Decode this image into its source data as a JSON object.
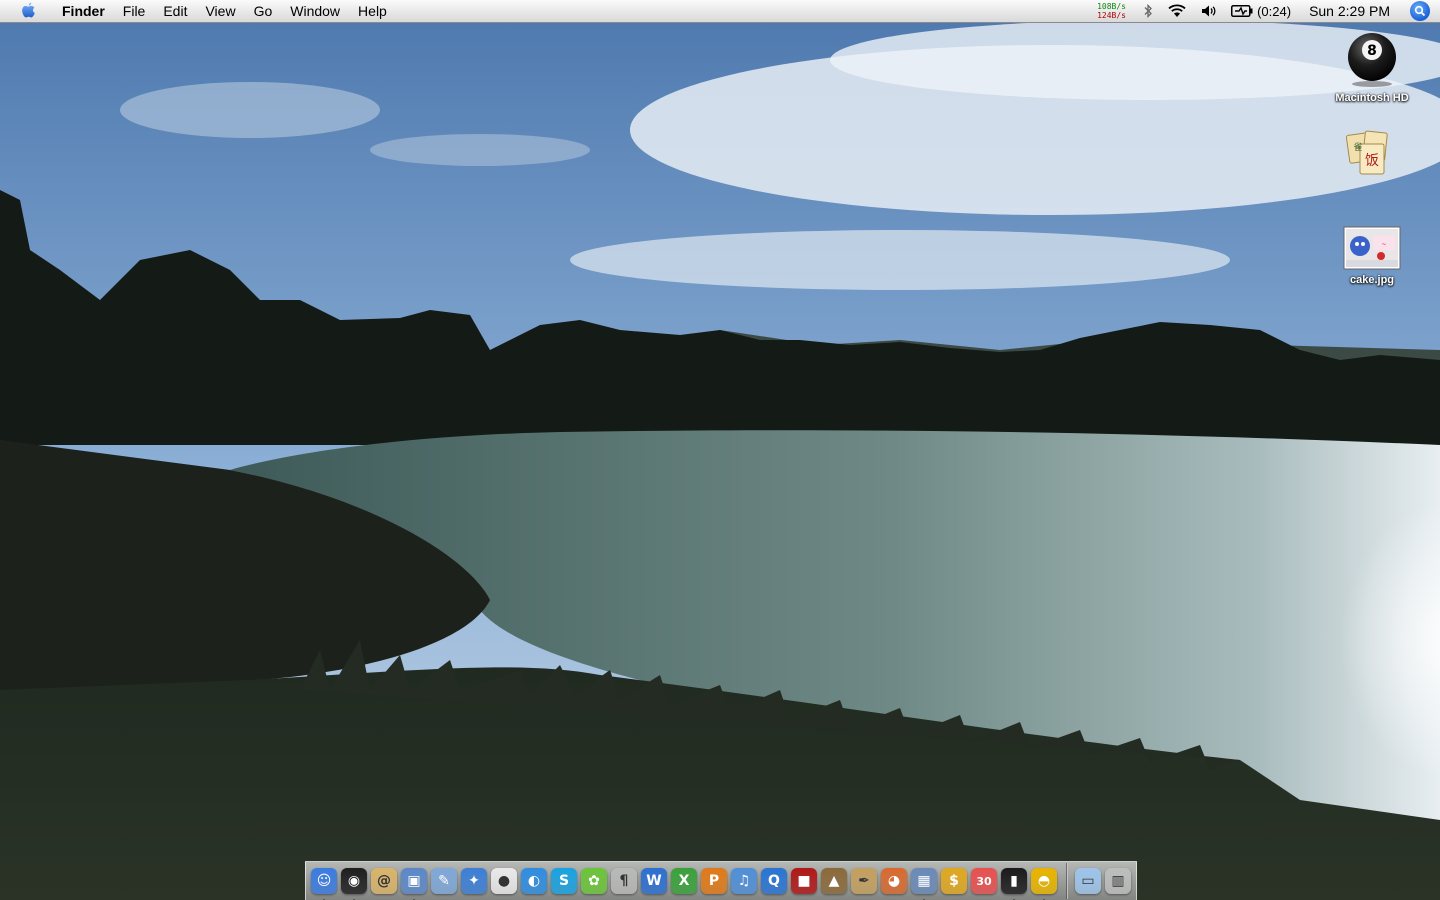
{
  "menubar": {
    "apple_icon": "apple-icon",
    "app_name": "Finder",
    "menus": [
      "File",
      "Edit",
      "View",
      "Go",
      "Window",
      "Help"
    ],
    "net_upload": "108B/s",
    "net_download": "124B/s",
    "bluetooth_icon": "bluetooth-icon",
    "wifi_icon": "wifi-icon",
    "volume_icon": "volume-icon",
    "battery_icon": "battery-icon",
    "battery_text": "(0:24)",
    "clock": "Sun 2:29 PM",
    "spotlight_icon": "spotlight-icon"
  },
  "desktop": {
    "wallpaper": "lake-landscape",
    "icons": [
      {
        "label": "Macintosh HD",
        "icon": "hard-drive-8-ball-icon"
      },
      {
        "label": "",
        "icon": "mahjong-tiles-icon"
      },
      {
        "label": "cake.jpg",
        "icon": "image-thumbnail-icon"
      }
    ]
  },
  "dock": {
    "apps": [
      {
        "name": "finder",
        "icon": "finder-icon",
        "glyph": "☺",
        "color": "#3b7be0",
        "running": true
      },
      {
        "name": "dashboard",
        "icon": "dashboard-icon",
        "glyph": "◉",
        "color": "#1e1e1e",
        "running": true
      },
      {
        "name": "mail",
        "icon": "mail-icon",
        "glyph": "@",
        "color": "#d9b46a",
        "running": false
      },
      {
        "name": "preview",
        "icon": "preview-icon",
        "glyph": "▣",
        "color": "#5b88c9",
        "running": true
      },
      {
        "name": "textedit",
        "icon": "textedit-icon",
        "glyph": "✎",
        "color": "#7fa8d8",
        "running": false
      },
      {
        "name": "network",
        "icon": "network-icon",
        "glyph": "✦",
        "color": "#3c7fd6",
        "running": false
      },
      {
        "name": "messages",
        "icon": "chat-bubble-icon",
        "glyph": "●",
        "color": "#e9e9e9",
        "running": false
      },
      {
        "name": "ichat",
        "icon": "ichat-icon",
        "glyph": "◐",
        "color": "#2f8de0",
        "running": false
      },
      {
        "name": "skype",
        "icon": "skype-icon",
        "glyph": "S",
        "color": "#1aa2e0",
        "running": false
      },
      {
        "name": "adium",
        "icon": "adium-icon",
        "glyph": "✿",
        "color": "#6cc43a",
        "running": false
      },
      {
        "name": "script",
        "icon": "script-icon",
        "glyph": "¶",
        "color": "#b8b8b8",
        "running": false
      },
      {
        "name": "word",
        "icon": "word-icon",
        "glyph": "W",
        "color": "#2d6fd1",
        "running": false
      },
      {
        "name": "excel",
        "icon": "excel-icon",
        "glyph": "X",
        "color": "#3aa13a",
        "running": false
      },
      {
        "name": "powerpoint",
        "icon": "powerpoint-icon",
        "glyph": "P",
        "color": "#e07a18",
        "running": false
      },
      {
        "name": "itunes",
        "icon": "itunes-icon",
        "glyph": "♫",
        "color": "#4f8fd8",
        "running": false
      },
      {
        "name": "quicktime",
        "icon": "quicktime-icon",
        "glyph": "Q",
        "color": "#2a74d4",
        "running": false
      },
      {
        "name": "photobooth",
        "icon": "photobooth-icon",
        "glyph": "■",
        "color": "#b01818",
        "running": false
      },
      {
        "name": "iphoto",
        "icon": "iphoto-icon",
        "glyph": "▲",
        "color": "#8a6a3a",
        "running": false
      },
      {
        "name": "pen",
        "icon": "pen-icon",
        "glyph": "✒",
        "color": "#c4a060",
        "running": false
      },
      {
        "name": "palette",
        "icon": "color-palette-icon",
        "glyph": "◕",
        "color": "#d86a30",
        "running": false
      },
      {
        "name": "photos",
        "icon": "photos-icon",
        "glyph": "▦",
        "color": "#6a8ab8",
        "running": true
      },
      {
        "name": "money",
        "icon": "dollar-icon",
        "glyph": "$",
        "color": "#e0a820",
        "running": false
      },
      {
        "name": "calendar",
        "icon": "calendar-icon",
        "glyph": "30",
        "color": "#e85050",
        "running": false
      },
      {
        "name": "terminal",
        "icon": "terminal-icon",
        "glyph": "▮",
        "color": "#1a1a1a",
        "running": true
      },
      {
        "name": "hardhat",
        "icon": "hard-hat-icon",
        "glyph": "◓",
        "color": "#e8b400",
        "running": true
      }
    ],
    "right": [
      {
        "name": "documents-folder",
        "icon": "folder-icon",
        "glyph": "▭",
        "color": "#9ec4ea",
        "running": false
      },
      {
        "name": "trash",
        "icon": "trash-icon",
        "glyph": "▥",
        "color": "#bdbdbd",
        "running": false
      }
    ]
  }
}
